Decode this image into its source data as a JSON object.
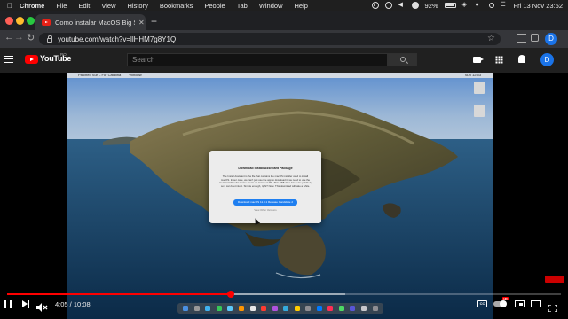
{
  "menubar": {
    "app": "Chrome",
    "items": [
      "File",
      "Edit",
      "View",
      "History",
      "Bookmarks",
      "People",
      "Tab",
      "Window",
      "Help"
    ],
    "battery": "92%",
    "datetime": "Fri 13 Nov  23:52"
  },
  "browser": {
    "tab_title": "Como instalar MacOS Big Sur e",
    "url": "youtube.com/watch?v=llHHM7g8Y1Q",
    "profile_initial": "D"
  },
  "youtube": {
    "logo_text": "YouTube",
    "country_code": "RO",
    "search_placeholder": "Search",
    "avatar_initial": "D"
  },
  "video": {
    "inner_menubar": [
      "Patched Sur – For Catalina",
      "Window"
    ],
    "inner_clock": "Sun 12:53",
    "dialog": {
      "title": "Download Install Assistant Package",
      "body": "The Install Assistant is the file that contains the macOS installer used to install macOS. In our case, we can't just use the app to download it, we need to use the createinstallmedia tool to create an installer USB. This USB drive has to be patched, so it can boot into it. Simple enough, right? Note: This download will take a while.",
      "button": "Download macOS 11.0.1 Release Candidate 2",
      "link": "View Other Versions"
    }
  },
  "player": {
    "current_time": "4:05",
    "duration": "10:08",
    "time_display": "4:05 / 10:08",
    "progress_fraction": 0.404,
    "buffered_fraction": 0.61,
    "hd_badge": "HD",
    "cc_label": "CC"
  },
  "colors": {
    "youtube_red": "#ff0000",
    "accent_blue": "#1a73e8"
  }
}
